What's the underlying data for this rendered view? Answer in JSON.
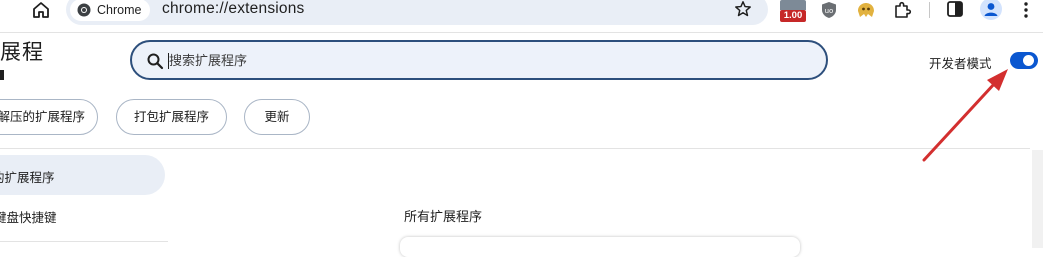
{
  "browser": {
    "chip_label": "Chrome",
    "url": "chrome://extensions",
    "extension_badge": "1.00",
    "icons": [
      "home-icon",
      "chrome-logo-icon",
      "star-icon",
      "ublock-icon",
      "tampermonkey-icon",
      "puzzle-icon",
      "side-panel-icon",
      "profile-icon",
      "kebab-menu-icon"
    ]
  },
  "header": {
    "title": "展程",
    "search_placeholder": "搜索扩展程序",
    "dev_mode_label": "开发者模式",
    "dev_mode_on": true
  },
  "actions": {
    "load_unpacked": "解压的扩展程序",
    "pack": "打包扩展程序",
    "update": "更新"
  },
  "nav": {
    "items": [
      {
        "label": "的扩展程序"
      },
      {
        "label": "键盘快捷键"
      }
    ]
  },
  "main": {
    "section_heading": "所有扩展程序"
  },
  "colors": {
    "accent": "#0b57d0",
    "annotation_arrow": "#d32f2f",
    "search_bg": "#edf2fa"
  }
}
